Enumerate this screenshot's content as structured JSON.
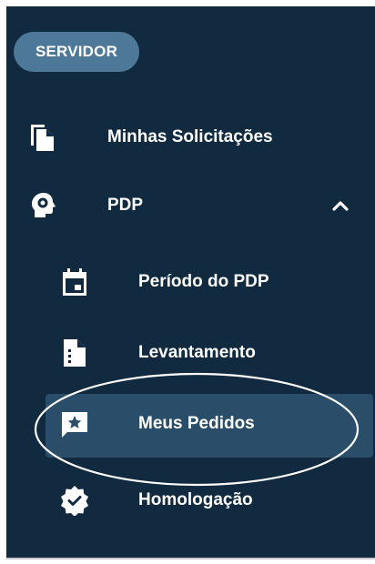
{
  "sidebar": {
    "role_chip": "SERVIDOR",
    "items": [
      {
        "label": "Minhas Solicitações",
        "icon": "copy-document-icon"
      },
      {
        "label": "PDP",
        "icon": "head-gear-icon",
        "expanded": true
      },
      {
        "label": "Período do PDP",
        "icon": "calendar-icon"
      },
      {
        "label": "Levantamento",
        "icon": "list-document-icon"
      },
      {
        "label": "Meus Pedidos",
        "icon": "feedback-star-icon",
        "active": true
      },
      {
        "label": "Homologação",
        "icon": "verified-badge-icon"
      }
    ]
  },
  "colors": {
    "sidebar_bg": "#112a40",
    "chip_bg": "#4e7898",
    "active_bg": "#2a4e69",
    "text": "#ffffff"
  }
}
